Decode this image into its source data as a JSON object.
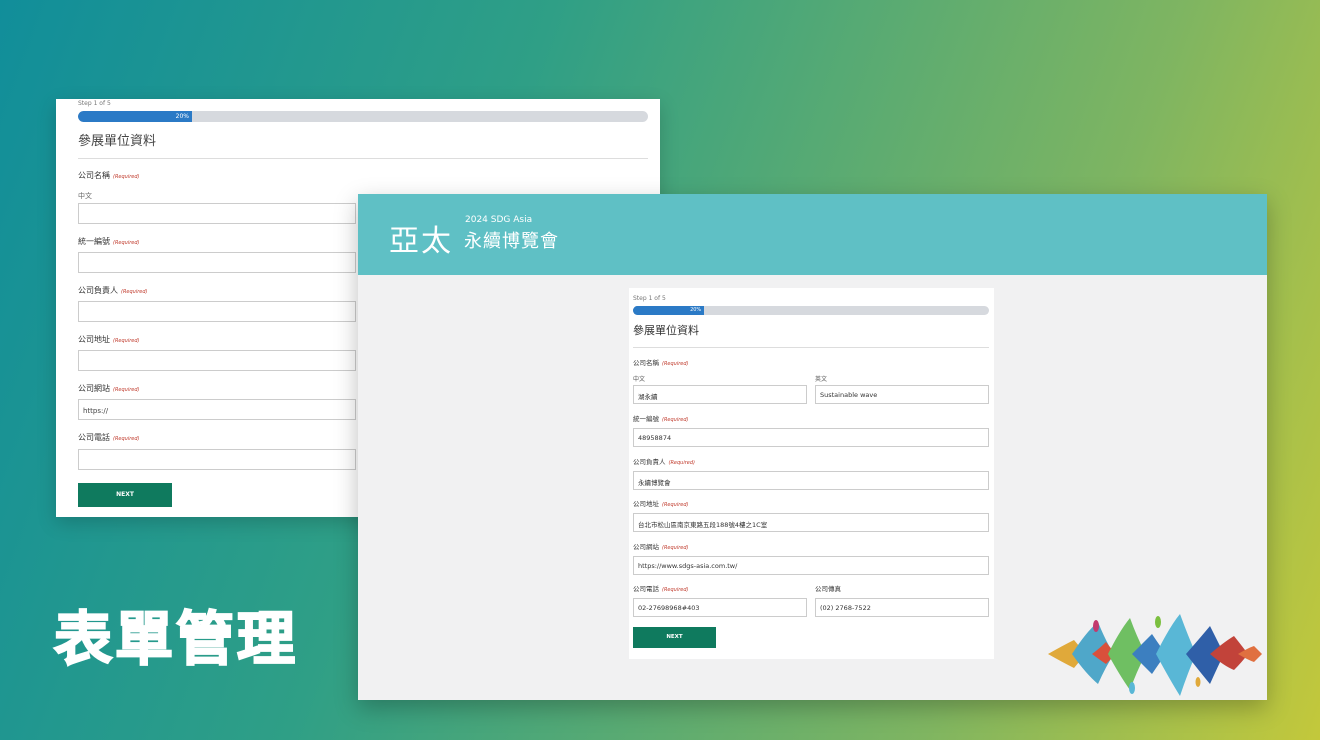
{
  "back_form": {
    "step": "Step 1 of 5",
    "progress_percent": 20,
    "progress_label": "20%",
    "title": "參展單位資料",
    "required": "(Required)",
    "fields": {
      "company_name": "公司名稱",
      "chinese": "中文",
      "tax_id": "統一編號",
      "owner": "公司負責人",
      "address": "公司地址",
      "website": "公司網站",
      "website_value": "https://",
      "phone": "公司電話"
    },
    "next": "NEXT"
  },
  "header": {
    "logo_main": "亞太",
    "logo_small": "2024 SDG Asia",
    "logo_sub": "永續博覽會"
  },
  "form": {
    "step": "Step 1 of 5",
    "progress_percent": 20,
    "progress_label": "20%",
    "title": "參展單位資料",
    "required": "(Required)",
    "company_name_label": "公司名稱",
    "chinese_label": "中文",
    "chinese_value": "湖永續",
    "english_label": "英文",
    "english_value": "Sustainable wave",
    "tax_id_label": "統一編號",
    "tax_id_value": "48958874",
    "owner_label": "公司負責人",
    "owner_value": "永續博覽會",
    "address_label": "公司地址",
    "address_value": "台北市松山區南京東路五段188號4樓之1C室",
    "website_label": "公司網站",
    "website_value": "https://www.sdgs-asia.com.tw/",
    "phone_label": "公司電話",
    "phone_value": "02-27698968#403",
    "fax_label": "公司傳真",
    "fax_value": "(02) 2768-7522",
    "next": "NEXT"
  },
  "caption": "表單管理",
  "colors": {
    "header": "#5fc0c5",
    "progress": "#2b7ac6",
    "button": "#0f7a5e"
  }
}
